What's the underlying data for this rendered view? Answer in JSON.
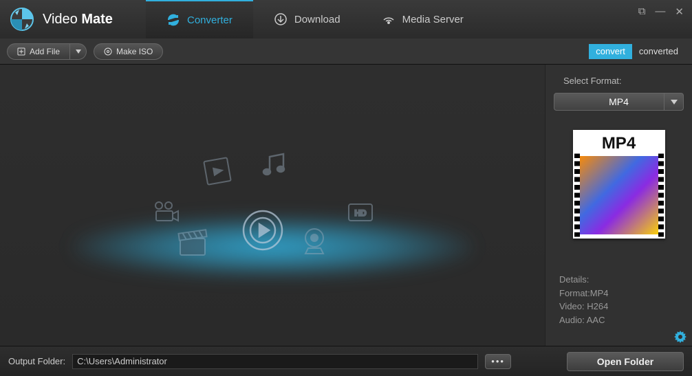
{
  "app": {
    "name_light": "Video",
    "name_bold": "Mate"
  },
  "tabs": {
    "converter": "Converter",
    "download": "Download",
    "media_server": "Media Server"
  },
  "toolbar": {
    "add_file": "Add File",
    "make_iso": "Make ISO"
  },
  "sub_tabs": {
    "convert": "convert",
    "converted": "converted"
  },
  "sidebar": {
    "select_format_label": "Select Format:",
    "format": "MP4",
    "preview_label": "MP4",
    "details_label": "Details:",
    "format_line": "Format:MP4",
    "video_line": "Video: H264",
    "audio_line": "Audio: AAC"
  },
  "footer": {
    "label": "Output Folder:",
    "path": "C:\\Users\\Administrator",
    "browse": "•••",
    "open_folder": "Open Folder"
  },
  "colors": {
    "accent": "#31b0de"
  }
}
